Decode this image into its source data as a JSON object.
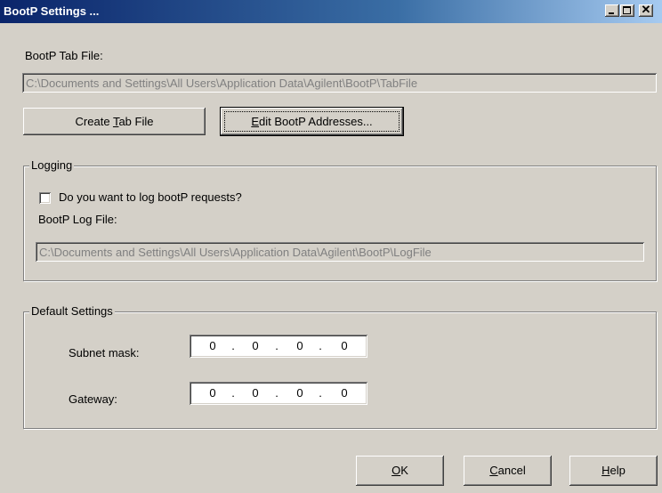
{
  "window": {
    "title": "BootP Settings ..."
  },
  "tab_file": {
    "label": "BootP Tab File:",
    "path": "C:\\Documents and Settings\\All Users\\Application Data\\Agilent\\BootP\\TabFile"
  },
  "buttons": {
    "create_tab": {
      "pre": "Create ",
      "accel": "T",
      "post": "ab File"
    },
    "edit_bootp": {
      "pre": "",
      "accel": "E",
      "post": "dit BootP Addresses..."
    },
    "ok": {
      "pre": "",
      "accel": "O",
      "post": "K"
    },
    "cancel": {
      "pre": "",
      "accel": "C",
      "post": "ancel"
    },
    "help": {
      "pre": "",
      "accel": "H",
      "post": "elp"
    }
  },
  "logging": {
    "title": "Logging",
    "checkbox_label": "Do you want to log bootP requests?",
    "checked": false,
    "log_file_label": "BootP Log File:",
    "log_file_path": "C:\\Documents and Settings\\All Users\\Application Data\\Agilent\\BootP\\LogFile"
  },
  "defaults": {
    "title": "Default Settings",
    "subnet_label": "Subnet mask:",
    "subnet": [
      "0",
      "0",
      "0",
      "0"
    ],
    "gateway_label": "Gateway:",
    "gateway": [
      "0",
      "0",
      "0",
      "0"
    ],
    "separator": "."
  }
}
